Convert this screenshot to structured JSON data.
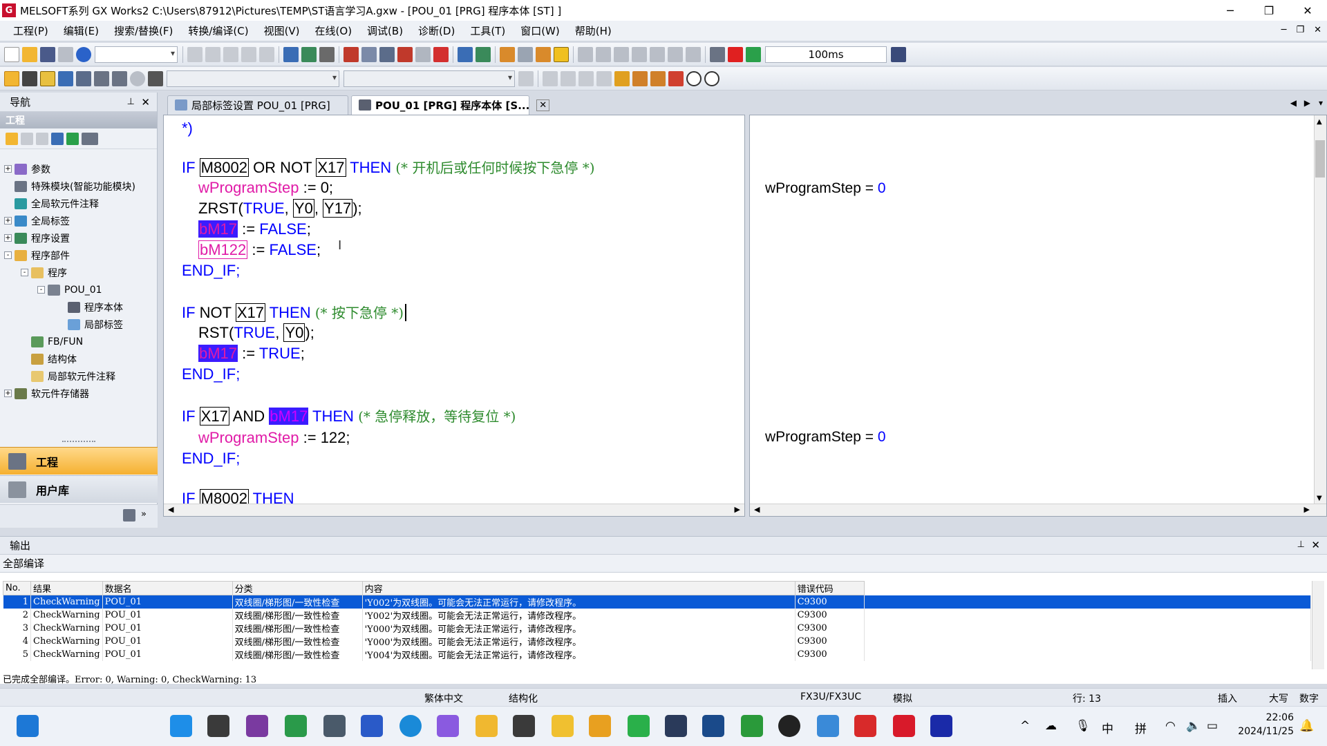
{
  "window": {
    "title": "MELSOFT系列 GX Works2 C:\\Users\\87912\\Pictures\\TEMP\\ST语言学习A.gxw - [POU_01 [PRG] 程序本体 [ST] ]",
    "minimize": "─",
    "restore": "❐",
    "close": "✕"
  },
  "menu": [
    "工程(P)",
    "编辑(E)",
    "搜索/替换(F)",
    "转换/编译(C)",
    "视图(V)",
    "在线(O)",
    "调试(B)",
    "诊断(D)",
    "工具(T)",
    "窗口(W)",
    "帮助(H)"
  ],
  "toolbar": {
    "monitor_interval": "100ms"
  },
  "nav": {
    "title": "导航",
    "section": "工程",
    "tree": [
      {
        "label": "参数",
        "level": 0,
        "exp": "+"
      },
      {
        "label": "特殊模块(智能功能模块)",
        "level": 0,
        "exp": ""
      },
      {
        "label": "全局软元件注释",
        "level": 0,
        "exp": ""
      },
      {
        "label": "全局标签",
        "level": 0,
        "exp": "+"
      },
      {
        "label": "程序设置",
        "level": 0,
        "exp": "+"
      },
      {
        "label": "程序部件",
        "level": 0,
        "exp": "-"
      },
      {
        "label": "程序",
        "level": 1,
        "exp": "-"
      },
      {
        "label": "POU_01",
        "level": 2,
        "exp": "-"
      },
      {
        "label": "程序本体",
        "level": 3,
        "exp": ""
      },
      {
        "label": "局部标签",
        "level": 3,
        "exp": ""
      },
      {
        "label": "FB/FUN",
        "level": 1,
        "exp": ""
      },
      {
        "label": "结构体",
        "level": 1,
        "exp": ""
      },
      {
        "label": "局部软元件注释",
        "level": 1,
        "exp": ""
      },
      {
        "label": "软元件存储器",
        "level": 0,
        "exp": "+"
      }
    ],
    "btn_project": "工程",
    "btn_library": "用户库"
  },
  "tabs": [
    {
      "label": "局部标签设置 POU_01 [PRG]"
    },
    {
      "label": "POU_01 [PRG] 程序本体 [S..."
    }
  ],
  "tab_close": "✕",
  "code": {
    "l0": "*)",
    "c1": "(* 开机后或任何时候按下急停 *)",
    "c2": "(* 按下急停 *)",
    "c3": "(* 急停释放，等待复位 *)"
  },
  "monitor": {
    "label": "wProgramStep = ",
    "value1": "0",
    "value2": "0"
  },
  "output": {
    "title": "输出",
    "subtitle": "全部编译",
    "columns": [
      "No.",
      "结果",
      "数据名",
      "分类",
      "内容",
      "错误代码"
    ],
    "rows": [
      {
        "no": "1",
        "result": "CheckWarning",
        "data": "POU_01",
        "cat": "双线圈/梯形图/一致性检查",
        "content": "'Y002'为双线圈。可能会无法正常运行，请修改程序。",
        "code": "C9300"
      },
      {
        "no": "2",
        "result": "CheckWarning",
        "data": "POU_01",
        "cat": "双线圈/梯形图/一致性检查",
        "content": "'Y002'为双线圈。可能会无法正常运行，请修改程序。",
        "code": "C9300"
      },
      {
        "no": "3",
        "result": "CheckWarning",
        "data": "POU_01",
        "cat": "双线圈/梯形图/一致性检查",
        "content": "'Y000'为双线圈。可能会无法正常运行，请修改程序。",
        "code": "C9300"
      },
      {
        "no": "4",
        "result": "CheckWarning",
        "data": "POU_01",
        "cat": "双线圈/梯形图/一致性检查",
        "content": "'Y000'为双线圈。可能会无法正常运行，请修改程序。",
        "code": "C9300"
      },
      {
        "no": "5",
        "result": "CheckWarning",
        "data": "POU_01",
        "cat": "双线圈/梯形图/一致性检查",
        "content": "'Y004'为双线圈。可能会无法正常运行，请修改程序。",
        "code": "C9300"
      }
    ],
    "status": "已完成全部编译。Error: 0, Warning: 0, CheckWarning: 13"
  },
  "statusbar": {
    "lang": "繁体中文",
    "mode": "结构化",
    "plc": "FX3U/FX3UC",
    "sim": "模拟",
    "line": "行: 13",
    "ins": "插入",
    "caps": "大写",
    "num": "数字"
  },
  "taskbar": {
    "time": "22:06",
    "date": "2024/11/25",
    "ime1": "中",
    "ime2": "拼"
  },
  "colors": {
    "keyword": "#0000ff",
    "comment": "#2e8b2e",
    "variable": "#e01ba7",
    "highlight": "#3b1cff",
    "selection": "#0a5ad6"
  }
}
